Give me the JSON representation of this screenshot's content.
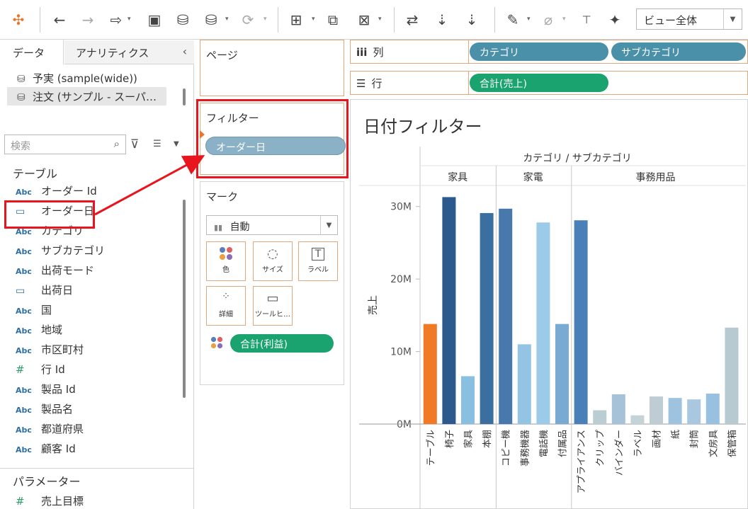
{
  "toolbar": {
    "view_select": "ビュー全体"
  },
  "datapane": {
    "tab_data": "データ",
    "tab_analytics": "アナリティクス",
    "sources": [
      {
        "label": "予実 (sample(wide))"
      },
      {
        "label": "注文 (サンプル - スーパ…"
      }
    ],
    "search_placeholder": "検索",
    "tables_header": "テーブル",
    "fields": [
      {
        "type": "Abc",
        "label": "オーダー Id"
      },
      {
        "type": "date",
        "label": "オーダー日"
      },
      {
        "type": "Abc",
        "label": "カテゴリ"
      },
      {
        "type": "Abc",
        "label": "サブカテゴリ"
      },
      {
        "type": "Abc",
        "label": "出荷モード"
      },
      {
        "type": "date",
        "label": "出荷日"
      },
      {
        "type": "Abc",
        "label": "国"
      },
      {
        "type": "Abc",
        "label": "地域"
      },
      {
        "type": "Abc",
        "label": "市区町村"
      },
      {
        "type": "num",
        "label": "行 Id"
      },
      {
        "type": "Abc",
        "label": "製品 Id"
      },
      {
        "type": "Abc",
        "label": "製品名"
      },
      {
        "type": "Abc",
        "label": "都道府県"
      },
      {
        "type": "Abc",
        "label": "顧客 Id"
      }
    ],
    "params_header": "パラメーター",
    "params": [
      {
        "type": "num",
        "label": "売上目標"
      }
    ]
  },
  "cards": {
    "pages_title": "ページ",
    "filters_title": "フィルター",
    "filter_pill": "オーダー日",
    "marks_title": "マーク",
    "mark_type": "自動",
    "mark_buttons": {
      "color": "色",
      "size": "サイズ",
      "label": "ラベル",
      "detail": "詳細",
      "tooltip": "ツールヒ…"
    },
    "color_pill": "合計(利益)"
  },
  "shelves": {
    "columns_label": "列",
    "columns_pills": [
      "カテゴリ",
      "サブカテゴリ"
    ],
    "rows_label": "行",
    "rows_pills": [
      "合計(売上)"
    ]
  },
  "chart_data": {
    "type": "bar",
    "title": "日付フィルター",
    "header": "カテゴリ / サブカテゴリ",
    "ylabel": "売上",
    "ylim": [
      0,
      33
    ],
    "yticks": [
      0,
      10,
      20,
      30
    ],
    "ytick_labels": [
      "0M",
      "10M",
      "20M",
      "30M"
    ],
    "groups": [
      {
        "name": "家具",
        "categories": [
          "テーブル",
          "椅子",
          "家具",
          "本棚"
        ],
        "values": [
          13.8,
          31.3,
          6.6,
          29.1
        ],
        "colors": [
          "#f07a26",
          "#2c5a8c",
          "#89bfe0",
          "#3b6fa0"
        ]
      },
      {
        "name": "家電",
        "categories": [
          "コピー機",
          "事務機器",
          "電話機",
          "付属品"
        ],
        "values": [
          29.7,
          11.0,
          27.8,
          13.8
        ],
        "colors": [
          "#4779ad",
          "#93c4e4",
          "#9bcbe8",
          "#79aad3"
        ]
      },
      {
        "name": "事務用品",
        "categories": [
          "アプライアンス",
          "クリップ",
          "バインダー",
          "ラベル",
          "画材",
          "紙",
          "封筒",
          "文房具",
          "保管箱"
        ],
        "values": [
          28.1,
          1.9,
          4.1,
          1.2,
          3.8,
          3.6,
          3.4,
          4.2,
          13.3
        ],
        "colors": [
          "#4a80b8",
          "#b9cdd3",
          "#a6c2d9",
          "#c4d3d8",
          "#bdcdd3",
          "#9ec3e0",
          "#a9c7df",
          "#98c0e1",
          "#b8cad1"
        ]
      }
    ]
  }
}
